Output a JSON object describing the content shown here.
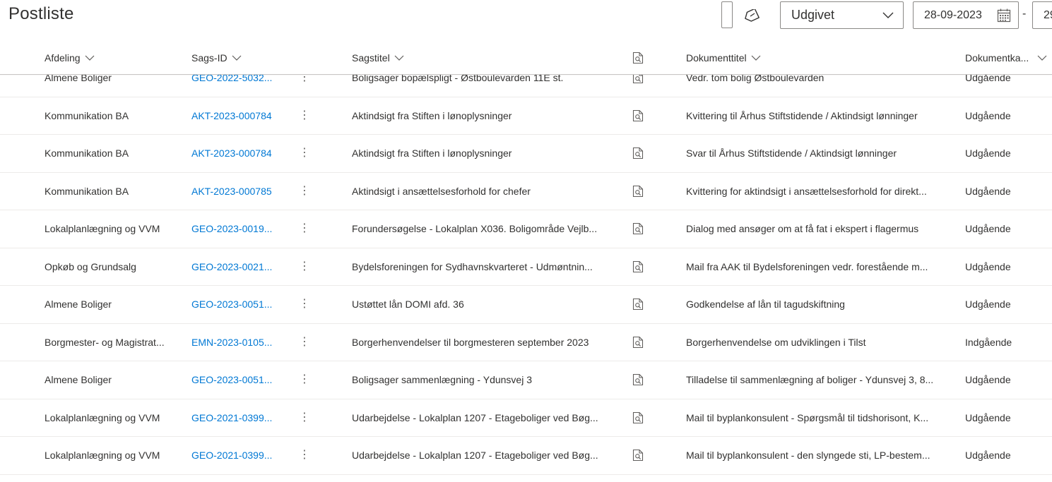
{
  "header": {
    "title": "Postliste",
    "dropdown_value": "Udgivet",
    "date_from": "28-09-2023",
    "date_separator": "-",
    "date_to": "29"
  },
  "columns": {
    "afdeling": "Afdeling",
    "sags_id": "Sags-ID",
    "sagstitel": "Sagstitel",
    "dokumenttitel": "Dokumenttitel",
    "dokumentkategori": "Dokumentka..."
  },
  "rows": [
    {
      "afdeling": "Almene Boliger",
      "sags_id": "GEO-2022-5032...",
      "sagstitel": "Boligsager bopælspligt - Østboulevarden 11E st.",
      "dokumenttitel": "Vedr. tom bolig Østboulevarden",
      "kategori": "Udgående"
    },
    {
      "afdeling": "Kommunikation BA",
      "sags_id": "AKT-2023-000784",
      "sagstitel": "Aktindsigt fra Stiften i lønoplysninger",
      "dokumenttitel": "Kvittering til Århus Stiftstidende / Aktindsigt lønninger",
      "kategori": "Udgående"
    },
    {
      "afdeling": "Kommunikation BA",
      "sags_id": "AKT-2023-000784",
      "sagstitel": "Aktindsigt fra Stiften i lønoplysninger",
      "dokumenttitel": "Svar til Århus Stiftstidende / Aktindsigt lønninger",
      "kategori": "Udgående"
    },
    {
      "afdeling": "Kommunikation BA",
      "sags_id": "AKT-2023-000785",
      "sagstitel": "Aktindsigt i ansættelsesforhold for chefer",
      "dokumenttitel": "Kvittering for aktindsigt i ansættelsesforhold for direkt...",
      "kategori": "Udgående"
    },
    {
      "afdeling": "Lokalplanlægning og VVM",
      "sags_id": "GEO-2023-0019...",
      "sagstitel": "Forundersøgelse - Lokalplan X036. Boligområde Vejlb...",
      "dokumenttitel": "Dialog med ansøger om at få fat i ekspert i flagermus",
      "kategori": "Udgående"
    },
    {
      "afdeling": "Opkøb og Grundsalg",
      "sags_id": "GEO-2023-0021...",
      "sagstitel": "Bydelsforeningen for Sydhavnskvarteret - Udmøntnin...",
      "dokumenttitel": "Mail fra AAK til Bydelsforeningen vedr. forestående m...",
      "kategori": "Udgående"
    },
    {
      "afdeling": "Almene Boliger",
      "sags_id": "GEO-2023-0051...",
      "sagstitel": "Ustøttet lån DOMI afd. 36",
      "dokumenttitel": "Godkendelse af lån til tagudskiftning",
      "kategori": "Udgående"
    },
    {
      "afdeling": "Borgmester- og Magistrat...",
      "sags_id": "EMN-2023-0105...",
      "sagstitel": "Borgerhenvendelser til borgmesteren september 2023",
      "dokumenttitel": "Borgerhenvendelse om udviklingen i Tilst",
      "kategori": "Indgående"
    },
    {
      "afdeling": "Almene Boliger",
      "sags_id": "GEO-2023-0051...",
      "sagstitel": "Boligsager sammenlægning - Ydunsvej 3",
      "dokumenttitel": "Tilladelse til sammenlægning af boliger - Ydunsvej 3, 8...",
      "kategori": "Udgående"
    },
    {
      "afdeling": "Lokalplanlægning og VVM",
      "sags_id": "GEO-2021-0399...",
      "sagstitel": "Udarbejdelse - Lokalplan 1207 - Etageboliger ved Bøg...",
      "dokumenttitel": "Mail til byplankonsulent - Spørgsmål til tidshorisont, K...",
      "kategori": "Udgående"
    },
    {
      "afdeling": "Lokalplanlægning og VVM",
      "sags_id": "GEO-2021-0399...",
      "sagstitel": "Udarbejdelse - Lokalplan 1207 - Etageboliger ved Bøg...",
      "dokumenttitel": "Mail til byplankonsulent - den slyngede sti, LP-bestem...",
      "kategori": "Udgående"
    }
  ],
  "icons": {
    "clear_filter": "clear-filter-icon",
    "dropdown_chevron": "chevron-down-icon",
    "calendar": "calendar-icon",
    "column_sort": "chevron-down-icon",
    "preview_header": "document-search-icon",
    "row_more": "more-vertical-icon",
    "row_preview": "document-search-icon"
  },
  "colors": {
    "link": "#0078d4",
    "text": "#323130",
    "border": "#8a8886",
    "row_divider": "#edebe9"
  }
}
